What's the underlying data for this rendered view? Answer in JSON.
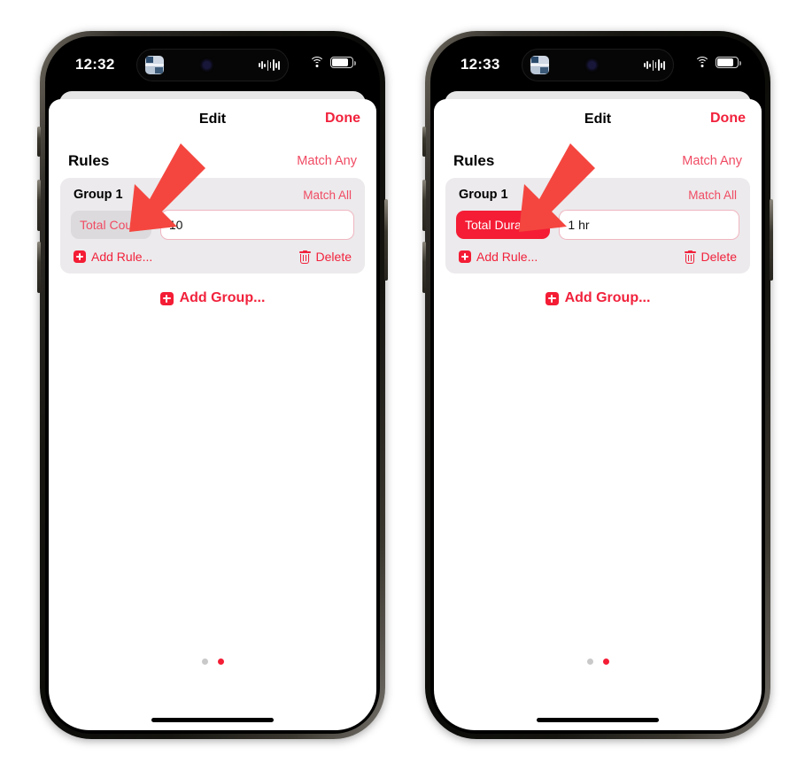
{
  "screens": [
    {
      "id": "screen-total-count",
      "status_bar": {
        "time": "12:32",
        "island_app_icon": "app-icon",
        "island_mic_icon": "mic-indicator-icon",
        "island_audio_icon": "audio-waveform-icon",
        "wifi_icon": "wifi-icon",
        "battery_icon": "battery-icon"
      },
      "nav": {
        "title": "Edit",
        "done_label": "Done"
      },
      "rules": {
        "title": "Rules",
        "match_label": "Match Any"
      },
      "group": {
        "name": "Group 1",
        "match_label": "Match All",
        "rule": {
          "pill_label": "Total Count",
          "pill_state": "inactive",
          "value": "10"
        },
        "add_rule_label": "Add Rule...",
        "delete_label": "Delete"
      },
      "add_group_label": "Add Group...",
      "page_dots": {
        "count": 2,
        "active_index": 1
      }
    },
    {
      "id": "screen-total-duration",
      "status_bar": {
        "time": "12:33",
        "island_app_icon": "app-icon",
        "island_mic_icon": "mic-indicator-icon",
        "island_audio_icon": "audio-waveform-icon",
        "wifi_icon": "wifi-icon",
        "battery_icon": "battery-icon"
      },
      "nav": {
        "title": "Edit",
        "done_label": "Done"
      },
      "rules": {
        "title": "Rules",
        "match_label": "Match Any"
      },
      "group": {
        "name": "Group 1",
        "match_label": "Match All",
        "rule": {
          "pill_label": "Total Duration",
          "pill_state": "active",
          "value": "1 hr"
        },
        "add_rule_label": "Add Rule...",
        "delete_label": "Delete"
      },
      "add_group_label": "Add Group...",
      "page_dots": {
        "count": 2,
        "active_index": 1
      }
    }
  ],
  "annotations": [
    {
      "name": "arrow-to-total-count",
      "direction": "down-left",
      "color": "#f4463f"
    },
    {
      "name": "arrow-to-total-duration",
      "direction": "down-left",
      "color": "#f4463f"
    }
  ],
  "colors": {
    "accent_red": "#f1223c",
    "pill_active_bg": "#f41d35",
    "pill_inactive_bg": "#dcdadc",
    "pill_inactive_text": "#f04b63",
    "card_bg": "#eceaec",
    "input_border": "#f0b6c1",
    "dot_inactive": "#c9c9c9",
    "dot_active": "#f41d35",
    "arrow": "#f4463f"
  }
}
